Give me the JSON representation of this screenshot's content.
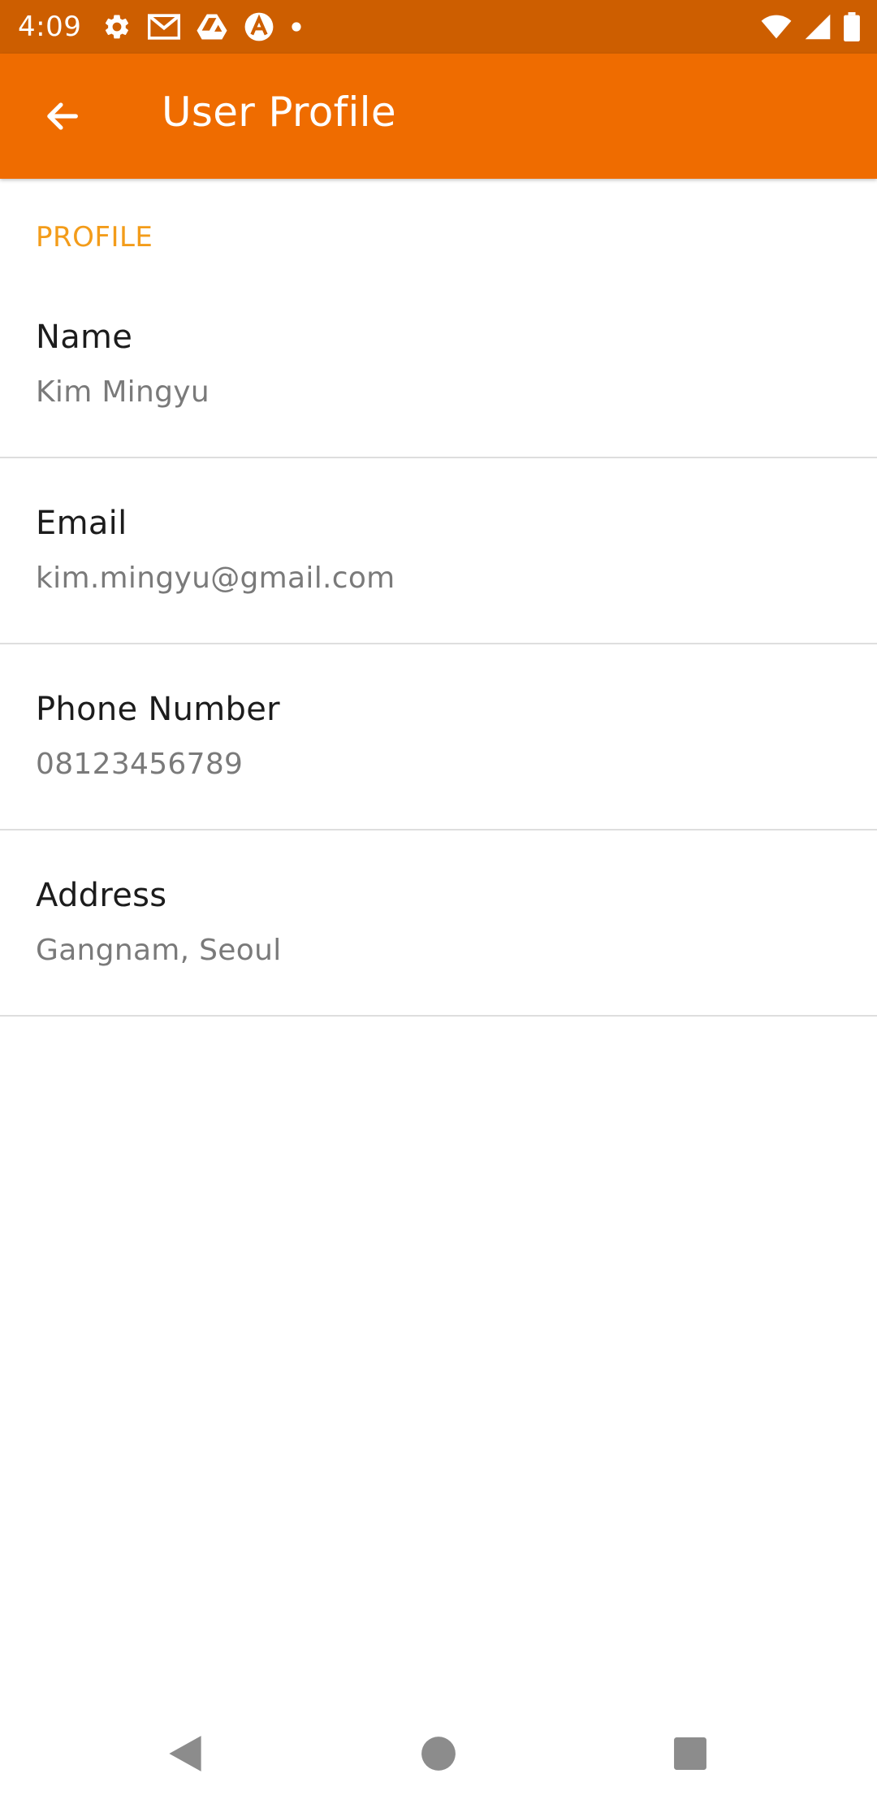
{
  "status_bar": {
    "time": "4:09",
    "background_color": "#cd5e00",
    "left_icons": [
      "settings-icon",
      "gmail-icon",
      "drive-icon",
      "app-a-icon",
      "notification-dot-icon"
    ],
    "right_icons": [
      "wifi-icon",
      "cell-signal-icon",
      "battery-icon"
    ]
  },
  "app_bar": {
    "title": "User Profile",
    "back_icon": "arrow-back-icon",
    "background_color": "#ef6c00"
  },
  "profile": {
    "section_header": "PROFILE",
    "accent_color": "#f39c1a",
    "items": [
      {
        "label": "Name",
        "value": "Kim Mingyu"
      },
      {
        "label": "Email",
        "value": "kim.mingyu@gmail.com"
      },
      {
        "label": "Phone Number",
        "value": "08123456789"
      },
      {
        "label": "Address",
        "value": "Gangnam, Seoul"
      }
    ]
  },
  "nav_bar": {
    "buttons": [
      "back-triangle-icon",
      "home-circle-icon",
      "recents-square-icon"
    ]
  }
}
